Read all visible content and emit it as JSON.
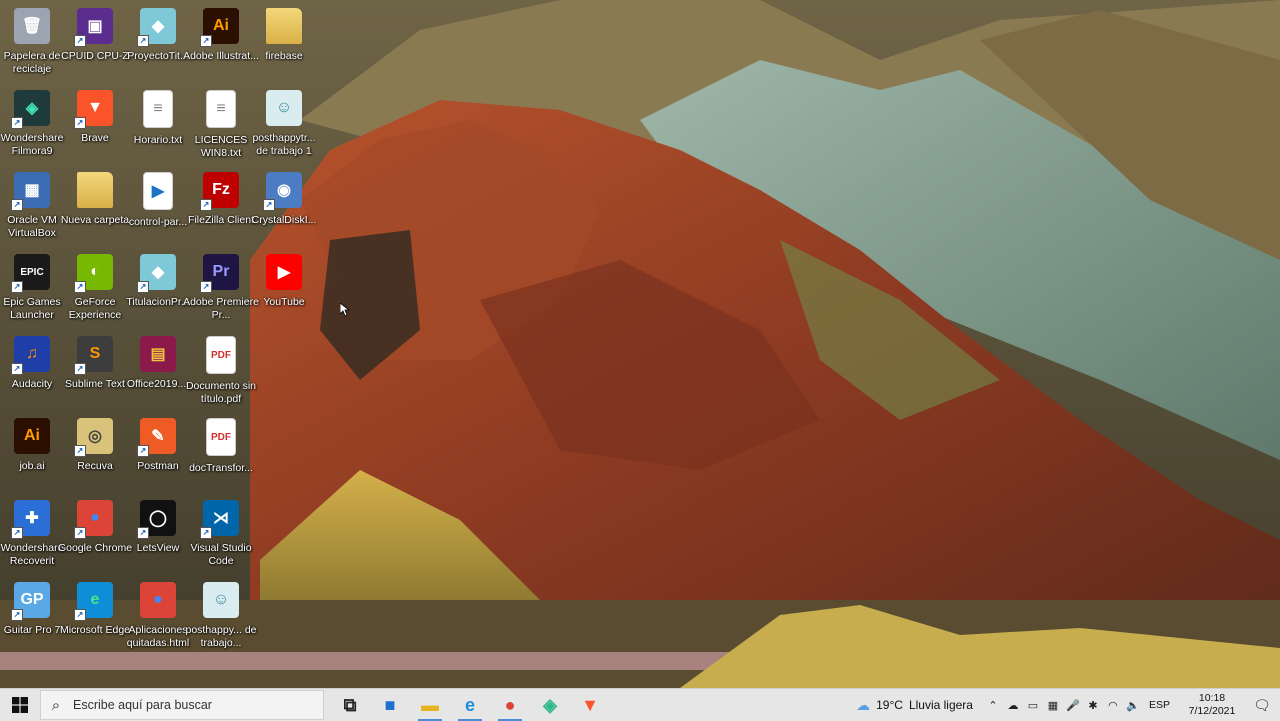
{
  "desktop": {
    "icons": [
      {
        "label": "Papelera de reciclaje",
        "icon": "recycle-bin-icon",
        "col": 0,
        "row": 0,
        "color": "#9aa5b1",
        "glyph": "🗑",
        "shortcut": false
      },
      {
        "label": "CPUID CPU-Z",
        "icon": "cpu-z-icon",
        "col": 1,
        "row": 0,
        "color": "#5b2d8e",
        "glyph": "▣",
        "shortcut": true
      },
      {
        "label": "ProyectoTit...",
        "icon": "glass-cube-icon",
        "col": 2,
        "row": 0,
        "color": "#7fc8d8",
        "glyph": "◆",
        "shortcut": true
      },
      {
        "label": "Adobe Illustrat...",
        "icon": "illustrator-icon",
        "col": 3,
        "row": 0,
        "color": "#2b0f00",
        "glyph": "Ai",
        "fg": "#ff9a00",
        "shortcut": true
      },
      {
        "label": "firebase",
        "icon": "folder-icon",
        "col": 4,
        "row": 0,
        "color": "#e8c860",
        "glyph": "",
        "shortcut": false
      },
      {
        "label": "Wondershare Filmora9",
        "icon": "filmora-icon",
        "col": 0,
        "row": 1,
        "color": "#1f3a3a",
        "glyph": "◈",
        "fg": "#3fe0b0",
        "shortcut": true
      },
      {
        "label": "Brave",
        "icon": "brave-icon",
        "col": 1,
        "row": 1,
        "color": "#fb542b",
        "glyph": "▼",
        "shortcut": true
      },
      {
        "label": "Horario.txt",
        "icon": "text-file-icon",
        "col": 2,
        "row": 1,
        "color": "#ffffff",
        "glyph": "≡",
        "fg": "#888",
        "shortcut": false
      },
      {
        "label": "LICENCES WIN8.txt",
        "icon": "text-file-icon",
        "col": 3,
        "row": 1,
        "color": "#ffffff",
        "glyph": "≡",
        "fg": "#888",
        "shortcut": false
      },
      {
        "label": "posthappytr... de trabajo 1",
        "icon": "image-file-icon",
        "col": 4,
        "row": 1,
        "color": "#d9ecef",
        "glyph": "☺",
        "fg": "#3a8a9a",
        "shortcut": false
      },
      {
        "label": "Oracle VM VirtualBox",
        "icon": "virtualbox-icon",
        "col": 0,
        "row": 2,
        "color": "#3b6db4",
        "glyph": "▦",
        "shortcut": true
      },
      {
        "label": "Nueva carpeta",
        "icon": "folder-icon",
        "col": 1,
        "row": 2,
        "color": "#e8c860",
        "glyph": "",
        "shortcut": false
      },
      {
        "label": "control-par...",
        "icon": "video-file-icon",
        "col": 2,
        "row": 2,
        "color": "#ffffff",
        "glyph": "▶",
        "fg": "#1a73c8",
        "shortcut": false
      },
      {
        "label": "FileZilla Client",
        "icon": "filezilla-icon",
        "col": 3,
        "row": 2,
        "color": "#bf0000",
        "glyph": "Fz",
        "shortcut": true
      },
      {
        "label": "CrystalDiskI...",
        "icon": "crystaldisk-icon",
        "col": 4,
        "row": 2,
        "color": "#4b7cc4",
        "glyph": "◉",
        "shortcut": true
      },
      {
        "label": "Epic Games Launcher",
        "icon": "epic-games-icon",
        "col": 0,
        "row": 3,
        "color": "#1a1a1a",
        "glyph": "EPIC",
        "shortcut": true
      },
      {
        "label": "GeForce Experience",
        "icon": "geforce-icon",
        "col": 1,
        "row": 3,
        "color": "#76b900",
        "glyph": "◐",
        "shortcut": true
      },
      {
        "label": "TitulacionPr...",
        "icon": "glass-cube-icon",
        "col": 2,
        "row": 3,
        "color": "#7fc8d8",
        "glyph": "◆",
        "shortcut": true
      },
      {
        "label": "Adobe Premiere Pr...",
        "icon": "premiere-icon",
        "col": 3,
        "row": 3,
        "color": "#1f1543",
        "glyph": "Pr",
        "fg": "#9999ff",
        "shortcut": true
      },
      {
        "label": "YouTube",
        "icon": "youtube-icon",
        "col": 4,
        "row": 3,
        "color": "#ff0000",
        "glyph": "▶",
        "shortcut": false
      },
      {
        "label": "Audacity",
        "icon": "audacity-icon",
        "col": 0,
        "row": 4,
        "color": "#1e3ea8",
        "glyph": "♫",
        "fg": "#ff8c00",
        "shortcut": true
      },
      {
        "label": "Sublime Text",
        "icon": "sublime-icon",
        "col": 1,
        "row": 4,
        "color": "#3d3d3d",
        "glyph": "S",
        "fg": "#ff9800",
        "shortcut": true
      },
      {
        "label": "Office2019....",
        "icon": "winrar-icon",
        "col": 2,
        "row": 4,
        "color": "#8b1a4a",
        "glyph": "▤",
        "fg": "#f0c040",
        "shortcut": false
      },
      {
        "label": "Documento sin título.pdf",
        "icon": "pdf-file-icon",
        "col": 3,
        "row": 4,
        "color": "#ffffff",
        "glyph": "PDF",
        "fg": "#d32f2f",
        "shortcut": false
      },
      {
        "label": "job.ai",
        "icon": "illustrator-file-icon",
        "col": 0,
        "row": 5,
        "color": "#2b0f00",
        "glyph": "Ai",
        "fg": "#ff9a00",
        "shortcut": false
      },
      {
        "label": "Recuva",
        "icon": "recuva-icon",
        "col": 1,
        "row": 5,
        "color": "#d9c27a",
        "glyph": "◎",
        "fg": "#444",
        "shortcut": true
      },
      {
        "label": "Postman",
        "icon": "postman-icon",
        "col": 2,
        "row": 5,
        "color": "#ef5b25",
        "glyph": "✎",
        "shortcut": true
      },
      {
        "label": "docTransfor...",
        "icon": "pdf-file-icon",
        "col": 3,
        "row": 5,
        "color": "#ffffff",
        "glyph": "PDF",
        "fg": "#d32f2f",
        "shortcut": false
      },
      {
        "label": "Wondershare Recoverit",
        "icon": "recoverit-icon",
        "col": 0,
        "row": 6,
        "color": "#2b6fd6",
        "glyph": "✚",
        "shortcut": true
      },
      {
        "label": "Google Chrome",
        "icon": "chrome-icon",
        "col": 1,
        "row": 6,
        "color": "#db4437",
        "glyph": "●",
        "fg": "#4285f4",
        "shortcut": true
      },
      {
        "label": "LetsView",
        "icon": "letsview-icon",
        "col": 2,
        "row": 6,
        "color": "#111111",
        "glyph": "◯",
        "shortcut": true
      },
      {
        "label": "Visual Studio Code",
        "icon": "vscode-icon",
        "col": 3,
        "row": 6,
        "color": "#0065a9",
        "glyph": "⋊",
        "shortcut": true
      },
      {
        "label": "Guitar Pro 7",
        "icon": "guitar-pro-icon",
        "col": 0,
        "row": 7,
        "color": "#5aa9e6",
        "glyph": "GP",
        "shortcut": true
      },
      {
        "label": "Microsoft Edge",
        "icon": "edge-icon",
        "col": 1,
        "row": 7,
        "color": "#0f8ed8",
        "glyph": "e",
        "fg": "#4de08a",
        "shortcut": true
      },
      {
        "label": "Aplicaciones quitadas.html",
        "icon": "chrome-html-icon",
        "col": 2,
        "row": 7,
        "color": "#db4437",
        "glyph": "●",
        "fg": "#4285f4",
        "shortcut": false
      },
      {
        "label": "posthappy... de trabajo...",
        "icon": "image-file-icon",
        "col": 3,
        "row": 7,
        "color": "#d9ecef",
        "glyph": "☺",
        "fg": "#3a8a9a",
        "shortcut": false
      }
    ]
  },
  "taskbar": {
    "search_placeholder": "Escribe aquí para buscar",
    "apps": [
      {
        "name": "task-view-icon",
        "glyph": "⧉",
        "color": "#222"
      },
      {
        "name": "microsoft-store-icon",
        "glyph": "■",
        "color": "#1f6fd0"
      },
      {
        "name": "file-explorer-icon",
        "glyph": "▬",
        "color": "#e6b422"
      },
      {
        "name": "edge-icon",
        "glyph": "e",
        "color": "#1f8fd8"
      },
      {
        "name": "chrome-icon",
        "glyph": "●",
        "color": "#db4437"
      },
      {
        "name": "filmora-icon",
        "glyph": "◈",
        "color": "#2fb88a"
      },
      {
        "name": "brave-icon",
        "glyph": "▼",
        "color": "#fb542b"
      }
    ],
    "weather": {
      "temp": "19°C",
      "condition": "Lluvia ligera"
    },
    "language": "ESP",
    "time": "10:18",
    "date": "7/12/2021"
  }
}
